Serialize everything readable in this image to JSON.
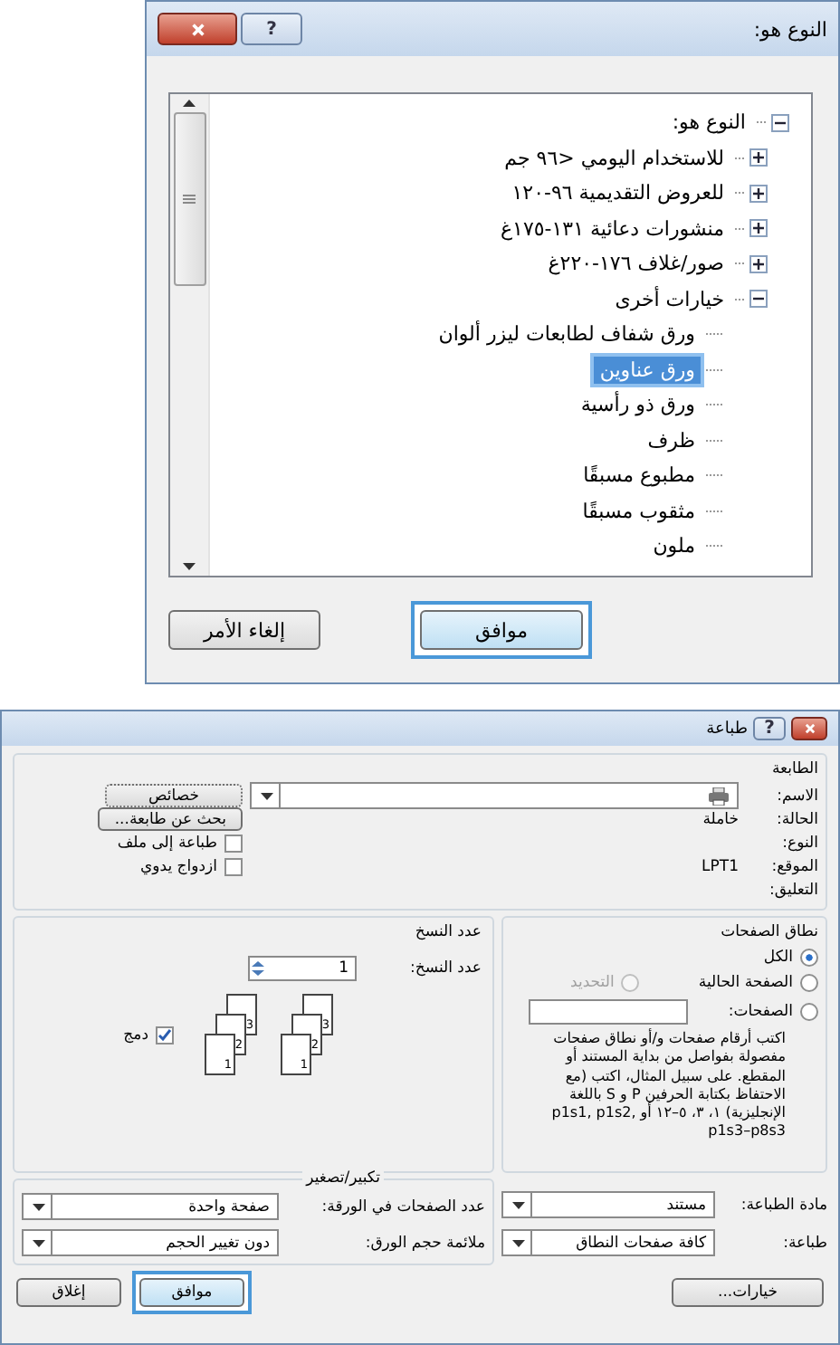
{
  "type_dialog": {
    "title": "النوع هو:",
    "help_button": "?",
    "tree": {
      "label": "النوع هو:",
      "expanded": true,
      "selected": false,
      "children": [
        {
          "label": "للاستخدام اليومي <٩٦ جم",
          "expanded": false,
          "selected": false
        },
        {
          "label": "للعروض التقديمية ٩٦-١٢٠",
          "expanded": false,
          "selected": false
        },
        {
          "label": "منشورات دعائية ١٣١-١٧٥غ",
          "expanded": false,
          "selected": false
        },
        {
          "label": "صور/غلاف ١٧٦-٢٢٠غ",
          "expanded": false,
          "selected": false
        },
        {
          "label": "خيارات أخرى",
          "expanded": true,
          "selected": false,
          "children": [
            {
              "label": "ورق شفاف لطابعات ليزر ألوان",
              "selected": false
            },
            {
              "label": "ورق عناوين",
              "selected": true
            },
            {
              "label": "ورق ذو رأسية",
              "selected": false
            },
            {
              "label": "ظرف",
              "selected": false
            },
            {
              "label": "مطبوع مسبقًا",
              "selected": false
            },
            {
              "label": "مثقوب مسبقًا",
              "selected": false
            },
            {
              "label": "ملون",
              "selected": false
            }
          ]
        }
      ]
    },
    "ok_button": "موافق",
    "cancel_button": "إلغاء الأمر"
  },
  "print_dialog": {
    "title": "طباعة",
    "help_button": "?",
    "printer": {
      "group": "الطابعة",
      "rows": [
        {
          "label": "الاسم:",
          "kind": "dropdown",
          "value": ""
        },
        {
          "label": "الحالة:",
          "kind": "text",
          "value": "خاملة"
        },
        {
          "label": "النوع:",
          "kind": "text",
          "value": ""
        },
        {
          "label": "الموقع:",
          "kind": "text",
          "value": "LPT1"
        },
        {
          "label": "التعليق:",
          "kind": "text",
          "value": ""
        }
      ],
      "buttons": [
        "خصائص",
        "بحث عن طابعة..."
      ],
      "checkboxes": [
        {
          "label": "طباعة إلى ملف",
          "checked": false
        },
        {
          "label": "ازدواج يدوي",
          "checked": false
        }
      ]
    },
    "page_range": {
      "group": "نطاق الصفحات",
      "options": [
        {
          "label": "الكل",
          "selected": true,
          "disabled": false
        },
        {
          "label": "الصفحة الحالية",
          "selected": false,
          "disabled": false
        },
        {
          "label": "التحديد",
          "selected": false,
          "disabled": true
        },
        {
          "label": "الصفحات:",
          "selected": false,
          "disabled": false
        }
      ],
      "help": "اكتب أرقام صفحات و/أو نطاق صفحات مفصولة بفواصل من بداية المستند أو المقطع. على سبيل المثال، اكتب (مع الاحتفاظ بكتابة الحرفين P و S باللغة الإنجليزية) ١، ٣، ٥–١٢ أو p1s1, p1s2, p1s3–p8s3"
    },
    "copies": {
      "group": "عدد النسخ",
      "label": "عدد النسخ:",
      "value": "1",
      "collate": {
        "label": "دمج",
        "checked": true
      },
      "stacks": [
        [
          "1",
          "2",
          "3"
        ],
        [
          "1",
          "2",
          "3"
        ]
      ]
    },
    "print_what": {
      "label": "مادة الطباعة:",
      "value": "مستند"
    },
    "print": {
      "label": "طباعة:",
      "value": "كافة صفحات النطاق"
    },
    "zoom": {
      "group": "تكبير/تصغير",
      "rows": [
        {
          "label": "عدد الصفحات في الورقة:",
          "value": "صفحة واحدة"
        },
        {
          "label": "ملائمة حجم الورق:",
          "value": "دون تغيير الحجم"
        }
      ]
    },
    "options_button": "خيارات...",
    "ok_button": "موافق",
    "close_button": "إغلاق"
  }
}
